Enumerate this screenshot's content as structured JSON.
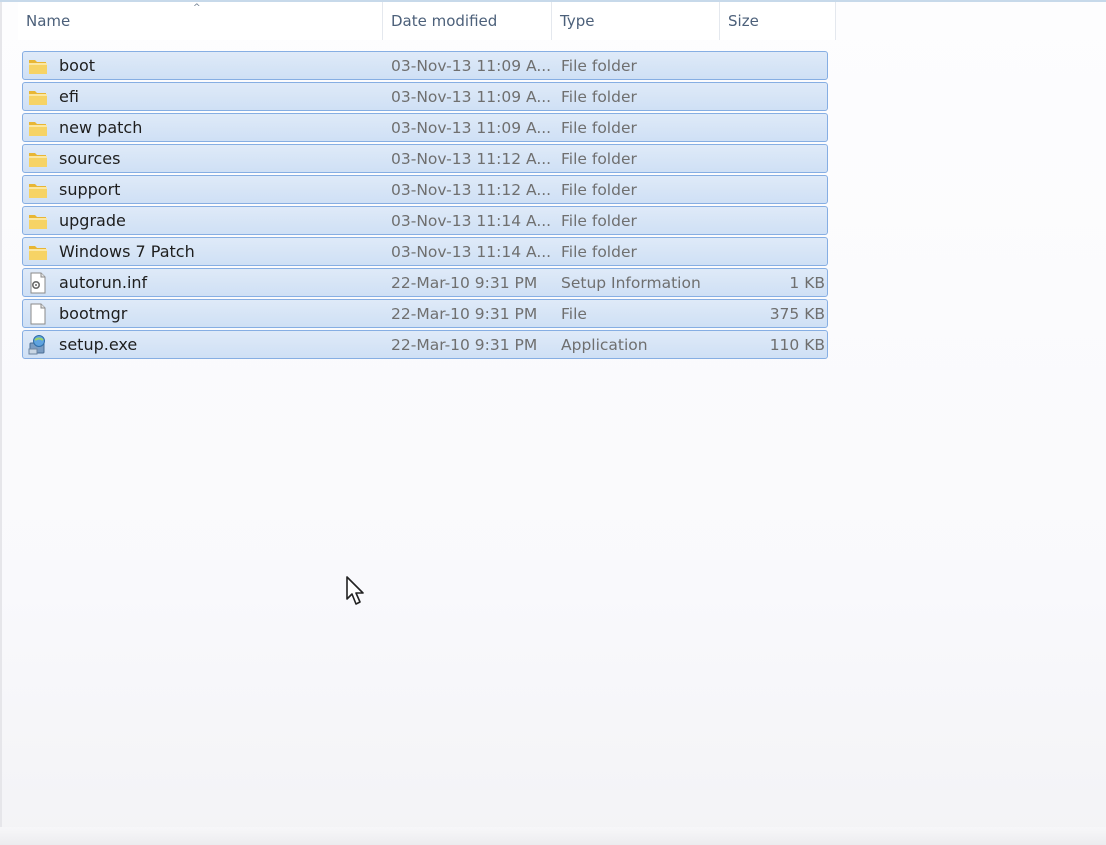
{
  "columns": {
    "name": "Name",
    "date": "Date modified",
    "type": "Type",
    "size": "Size"
  },
  "sort_indicator": "^",
  "files": [
    {
      "name": "boot",
      "date": "03-Nov-13 11:09 A...",
      "type": "File folder",
      "size": "",
      "icon": "folder-icon"
    },
    {
      "name": "efi",
      "date": "03-Nov-13 11:09 A...",
      "type": "File folder",
      "size": "",
      "icon": "folder-icon"
    },
    {
      "name": "new patch",
      "date": "03-Nov-13 11:09 A...",
      "type": "File folder",
      "size": "",
      "icon": "folder-icon"
    },
    {
      "name": "sources",
      "date": "03-Nov-13 11:12 A...",
      "type": "File folder",
      "size": "",
      "icon": "folder-icon"
    },
    {
      "name": "support",
      "date": "03-Nov-13 11:12 A...",
      "type": "File folder",
      "size": "",
      "icon": "folder-icon"
    },
    {
      "name": "upgrade",
      "date": "03-Nov-13 11:14 A...",
      "type": "File folder",
      "size": "",
      "icon": "folder-icon"
    },
    {
      "name": "Windows 7 Patch",
      "date": "03-Nov-13 11:14 A...",
      "type": "File folder",
      "size": "",
      "icon": "folder-icon"
    },
    {
      "name": "autorun.inf",
      "date": "22-Mar-10 9:31 PM",
      "type": "Setup Information",
      "size": "1 KB",
      "icon": "settings-file-icon"
    },
    {
      "name": "bootmgr",
      "date": "22-Mar-10 9:31 PM",
      "type": "File",
      "size": "375 KB",
      "icon": "blank-file-icon"
    },
    {
      "name": "setup.exe",
      "date": "22-Mar-10 9:31 PM",
      "type": "Application",
      "size": "110 KB",
      "icon": "setup-app-icon"
    }
  ],
  "colors": {
    "selection_fill": "#cfe0f5",
    "selection_border": "#86aee3",
    "header_text": "#4c607a",
    "folder_yellow": "#f2c94c"
  }
}
